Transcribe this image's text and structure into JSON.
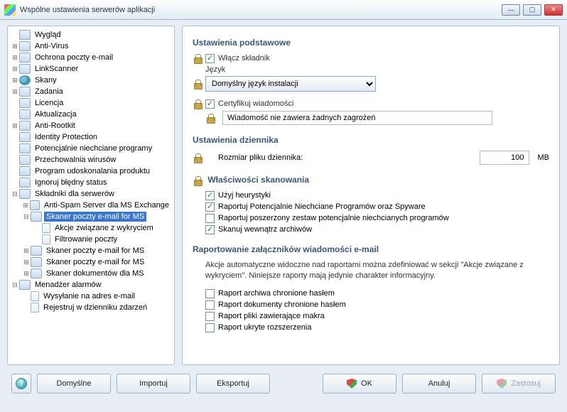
{
  "window": {
    "title": "Wspólne ustawienia serwerów aplikacji"
  },
  "tree": [
    {
      "d": 1,
      "exp": "",
      "icon": "node",
      "label": "Wygląd"
    },
    {
      "d": 1,
      "exp": "+",
      "icon": "node",
      "label": "Anti-Virus"
    },
    {
      "d": 1,
      "exp": "+",
      "icon": "node",
      "label": "Ochrona poczty e-mail"
    },
    {
      "d": 1,
      "exp": "+",
      "icon": "node",
      "label": "LinkScanner"
    },
    {
      "d": 1,
      "exp": "+",
      "icon": "scan",
      "label": "Skany"
    },
    {
      "d": 1,
      "exp": "+",
      "icon": "node",
      "label": "Zadania"
    },
    {
      "d": 1,
      "exp": "",
      "icon": "node",
      "label": "Licencja"
    },
    {
      "d": 1,
      "exp": "",
      "icon": "node",
      "label": "Aktualizacja"
    },
    {
      "d": 1,
      "exp": "+",
      "icon": "node",
      "label": "Anti-Rootkit"
    },
    {
      "d": 1,
      "exp": "",
      "icon": "node",
      "label": "Identity Protection"
    },
    {
      "d": 1,
      "exp": "",
      "icon": "node",
      "label": "Potencjalnie niechciane programy"
    },
    {
      "d": 1,
      "exp": "",
      "icon": "node",
      "label": "Przechowalnia wirusów"
    },
    {
      "d": 1,
      "exp": "",
      "icon": "node",
      "label": "Program udoskonalania produktu"
    },
    {
      "d": 1,
      "exp": "",
      "icon": "node",
      "label": "Ignoruj błędny status"
    },
    {
      "d": 1,
      "exp": "−",
      "icon": "node",
      "label": "Składniki dla serwerów"
    },
    {
      "d": 2,
      "exp": "+",
      "icon": "node",
      "label": "Anti-Spam Server dla MS Exchange"
    },
    {
      "d": 2,
      "exp": "−",
      "icon": "node",
      "label": "Skaner poczty e-mail for MS",
      "selected": true
    },
    {
      "d": 3,
      "exp": "",
      "icon": "doc",
      "label": "Akcje związane z wykryciem"
    },
    {
      "d": 3,
      "exp": "",
      "icon": "doc",
      "label": "Filtrowanie poczty"
    },
    {
      "d": 2,
      "exp": "+",
      "icon": "node",
      "label": "Skaner poczty e-mail for MS"
    },
    {
      "d": 2,
      "exp": "+",
      "icon": "node",
      "label": "Skaner poczty e-mail for MS"
    },
    {
      "d": 2,
      "exp": "+",
      "icon": "node",
      "label": "Skaner dokumentów dla MS"
    },
    {
      "d": 1,
      "exp": "−",
      "icon": "node",
      "label": "Menadżer alarmów"
    },
    {
      "d": 2,
      "exp": "",
      "icon": "doc",
      "label": "Wysyłanie na adres e-mail"
    },
    {
      "d": 2,
      "exp": "",
      "icon": "doc",
      "label": "Rejestruj w dzienniku zdarzeń"
    }
  ],
  "basic": {
    "heading": "Ustawienia podstawowe",
    "enable_label": "Włącz składnik",
    "language_label": "Język",
    "language_value": "Domyślny język instalacji",
    "certify_label": "Certyfikuj wiadomości",
    "certify_text": "Wiadomość nie zawiera żadnych zagrożeń"
  },
  "log": {
    "heading": "Ustawienia dziennika",
    "size_label": "Rozmiar pliku dziennika:",
    "size_value": "100",
    "size_unit": "MB"
  },
  "scan": {
    "heading": "Właściwości skanowania",
    "heuristics": "Użyj heurystyki",
    "pup": "Raportuj Potencjalnie Niechciane Programów oraz Spyware",
    "ext_pup": "Raportuj poszerzony zestaw potencjalnie niechcianych programów",
    "inside": "Skanuj wewnątrz archiwów"
  },
  "attach": {
    "heading": "Raportowanie załączników wiadomości e-mail",
    "desc": "Akcje automatyczne widoczne nad raportami można zdefiniować w sekcji \"Akcje związane z wykryciem\". Niniejsze raporty mają jedynie charakter informacyjny.",
    "r1": "Raport archiwa chronione hasłem",
    "r2": "Raport dokumenty chronione hasłem",
    "r3": "Raport pliki zawierające makra",
    "r4": "Raport ukryte rozszerzenia"
  },
  "buttons": {
    "defaults": "Domyślne",
    "import": "Importuj",
    "export": "Eksportuj",
    "ok": "OK",
    "cancel": "Anuluj",
    "apply": "Zastosuj"
  }
}
